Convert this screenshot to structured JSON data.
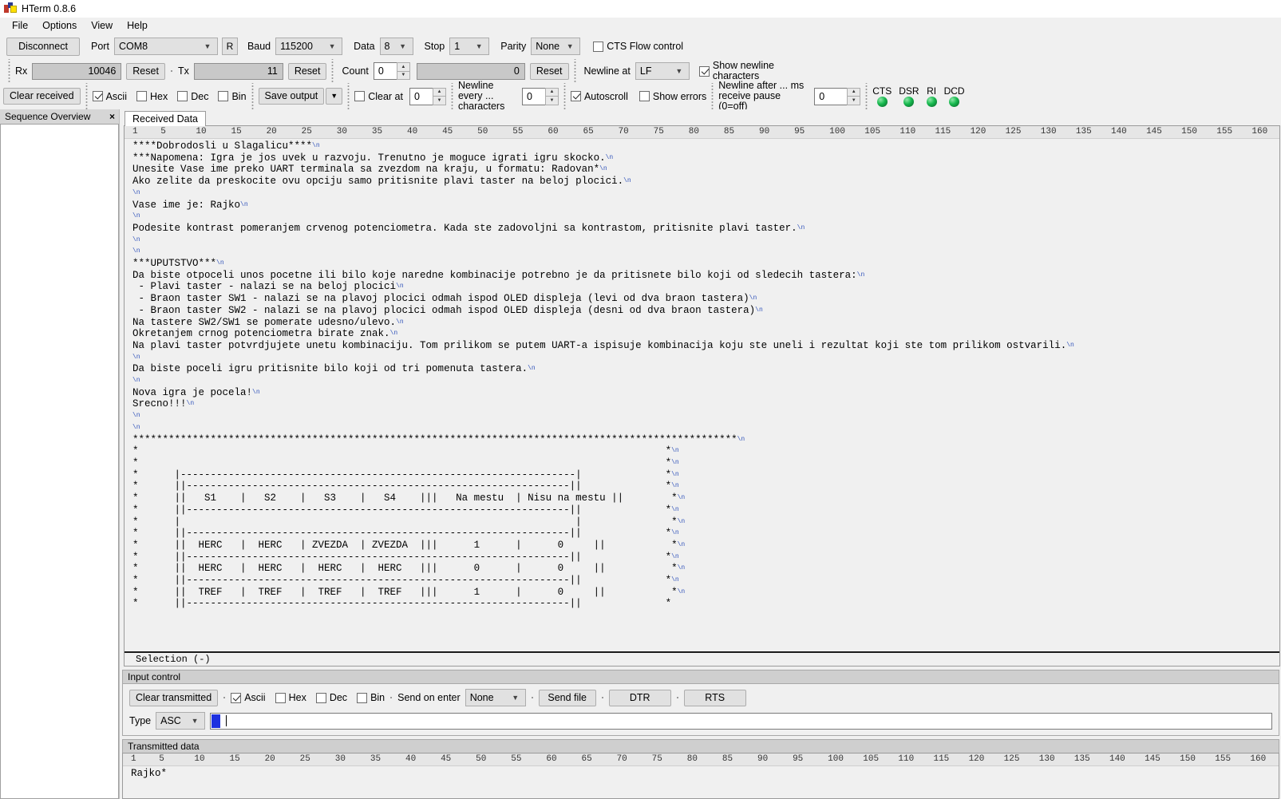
{
  "window": {
    "title": "HTerm 0.8.6",
    "icon": "hterm-logo-icon"
  },
  "menu": {
    "items": [
      {
        "label": "File"
      },
      {
        "label": "Options"
      },
      {
        "label": "View"
      },
      {
        "label": "Help"
      }
    ]
  },
  "toolbar": {
    "row1": {
      "disconnect_label": "Disconnect",
      "port_label": "Port",
      "port_value": "COM8",
      "rescan_label": "R",
      "baud_label": "Baud",
      "baud_value": "115200",
      "data_label": "Data",
      "data_value": "8",
      "stop_label": "Stop",
      "stop_value": "1",
      "parity_label": "Parity",
      "parity_value": "None",
      "cts_flow_label": "CTS Flow control",
      "cts_flow_checked": false
    },
    "row2": {
      "rx_label": "Rx",
      "rx_value": "10046",
      "rx_reset_label": "Reset",
      "tx_label": "Tx",
      "tx_value": "11",
      "tx_reset_label": "Reset",
      "count_label": "Count",
      "count_value": "0",
      "count_total": "0",
      "count_reset_label": "Reset",
      "newline_at_label": "Newline at",
      "newline_at_value": "LF",
      "show_newline_label": "Show newline characters",
      "show_newline_checked": true
    },
    "row3": {
      "clear_received_label": "Clear received",
      "ascii_label": "Ascii",
      "ascii_checked": true,
      "hex_label": "Hex",
      "hex_checked": false,
      "dec_label": "Dec",
      "dec_checked": false,
      "bin_label": "Bin",
      "bin_checked": false,
      "save_output_label": "Save output",
      "clear_at_label": "Clear at",
      "clear_at_value": "0",
      "newline_every_label": "Newline every ... characters",
      "newline_every_value": "0",
      "autoscroll_label": "Autoscroll",
      "autoscroll_checked": true,
      "show_errors_label": "Show errors",
      "show_errors_checked": false,
      "newline_after_label": "Newline after ... ms receive pause (0=off)",
      "newline_after_value": "0",
      "leds": [
        {
          "name": "CTS"
        },
        {
          "name": "DSR"
        },
        {
          "name": "RI"
        },
        {
          "name": "DCD"
        }
      ]
    }
  },
  "dock": {
    "title": "Sequence Overview",
    "close_label": "×"
  },
  "received": {
    "tab_label": "Received Data",
    "ruler_ticks": [
      "1",
      "5",
      "10",
      "15",
      "20",
      "25",
      "30",
      "35",
      "40",
      "45",
      "50",
      "55",
      "60",
      "65",
      "70",
      "75",
      "80",
      "85",
      "90",
      "95",
      "100",
      "105",
      "110",
      "115",
      "120",
      "125",
      "130",
      "135",
      "140",
      "145",
      "150",
      "155",
      "160"
    ],
    "selection_label": "Selection (-)",
    "lines": [
      "****Dobrodosli u Slagalicu****\\n",
      "***Napomena: Igra je jos uvek u razvoju. Trenutno je moguce igrati igru skocko.\\n",
      "Unesite Vase ime preko UART terminala sa zvezdom na kraju, u formatu: Radovan*\\n",
      "Ako zelite da preskocite ovu opciju samo pritisnite plavi taster na beloj plocici.\\n",
      "\\n",
      "Vase ime je: Rajko\\n",
      "\\n",
      "Podesite kontrast pomeranjem crvenog potenciometra. Kada ste zadovoljni sa kontrastom, pritisnite plavi taster.\\n",
      "\\n",
      "\\n",
      "***UPUTSTVO***\\n",
      "Da biste otpoceli unos pocetne ili bilo koje naredne kombinacije potrebno je da pritisnete bilo koji od sledecih tastera:\\n",
      " - Plavi taster - nalazi se na beloj plocici\\n",
      " - Braon taster SW1 - nalazi se na plavoj plocici odmah ispod OLED displeja (levi od dva braon tastera)\\n",
      " - Braon taster SW2 - nalazi se na plavoj plocici odmah ispod OLED displeja (desni od dva braon tastera)\\n",
      "Na tastere SW2/SW1 se pomerate udesno/ulevo.\\n",
      "Okretanjem crnog potenciometra birate znak.\\n",
      "Na plavi taster potvrdjujete unetu kombinaciju. Tom prilikom se putem UART-a ispisuje kombinacija koju ste uneli i rezultat koji ste tom prilikom ostvarili.\\n",
      "\\n",
      "Da biste poceli igru pritisnite bilo koji od tri pomenuta tastera.\\n",
      "\\n",
      "Nova igra je pocela!\\n",
      "Srecno!!!\\n",
      "\\n",
      "\\n",
      "*****************************************************************************************************\\n",
      "*                                                                                        *\\n",
      "*                                                                                        *\\n",
      "*      |------------------------------------------------------------------|              *\\n",
      "*      ||----------------------------------------------------------------||              *\\n",
      "*      ||   S1    |   S2    |   S3    |   S4    |||   Na mestu  | Nisu na mestu ||        *\\n",
      "*      ||----------------------------------------------------------------||              *\\n",
      "*      |                                                                  |               *\\n",
      "*      ||----------------------------------------------------------------||              *\\n",
      "*      ||  HERC   |  HERC   | ZVEZDA  | ZVEZDA  |||      1      |      0     ||           *\\n",
      "*      ||----------------------------------------------------------------||              *\\n",
      "*      ||  HERC   |  HERC   |  HERC   |  HERC   |||      0      |      0     ||           *\\n",
      "*      ||----------------------------------------------------------------||              *\\n",
      "*      ||  TREF   |  TREF   |  TREF   |  TREF   |||      1      |      0     ||           *\\n",
      "*      ||----------------------------------------------------------------||              *"
    ]
  },
  "input_control": {
    "caption": "Input control",
    "clear_transmitted_label": "Clear transmitted",
    "ascii_label": "Ascii",
    "ascii_checked": true,
    "hex_label": "Hex",
    "hex_checked": false,
    "dec_label": "Dec",
    "dec_checked": false,
    "bin_label": "Bin",
    "bin_checked": false,
    "send_on_enter_label": "Send on enter",
    "send_on_enter_value": "None",
    "send_file_label": "Send file",
    "dtr_label": "DTR",
    "rts_label": "RTS",
    "type_label": "Type",
    "type_value": "ASC",
    "type_input_value": ""
  },
  "transmitted": {
    "caption": "Transmitted data",
    "ruler_ticks": [
      "1",
      "5",
      "10",
      "15",
      "20",
      "25",
      "30",
      "35",
      "40",
      "45",
      "50",
      "55",
      "60",
      "65",
      "70",
      "75",
      "80",
      "85",
      "90",
      "95",
      "100",
      "105",
      "110",
      "115",
      "120",
      "125",
      "130",
      "135",
      "140",
      "145",
      "150",
      "155",
      "160"
    ],
    "lines": [
      "Rajko*"
    ]
  },
  "colors": {
    "face": "#f0f0f0",
    "led_green": "#16b84e",
    "caret_blue": "#1d31e0",
    "newline_marker": "#3355bb"
  }
}
